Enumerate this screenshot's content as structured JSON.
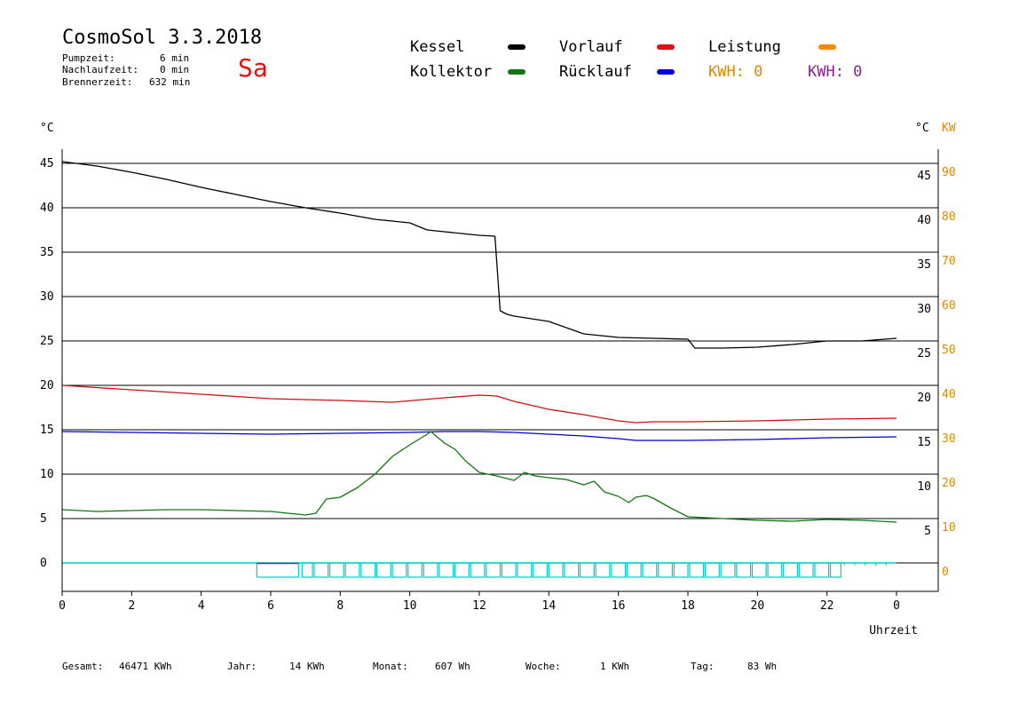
{
  "header": {
    "title": "CosmoSol 3.3.2018",
    "day": "Sa",
    "stats": [
      {
        "label": "Pumpzeit:",
        "value": "6 min"
      },
      {
        "label": "Nachlaufzeit:",
        "value": "0 min"
      },
      {
        "label": "Brennerzeit:",
        "value": "632 min"
      }
    ]
  },
  "legend": {
    "kessel": "Kessel",
    "vorlauf": "Vorlauf",
    "leistung": "Leistung",
    "kollektor": "Kollektor",
    "ruecklauf": "Rücklauf",
    "kwh1": "KWH: 0",
    "kwh2": "KWH: 0"
  },
  "colors": {
    "kessel": "#000000",
    "vorlauf": "#cc1111",
    "ruecklauf": "#0000cc",
    "kollektor": "#117711",
    "leistung": "#ff8800",
    "burner": "#00cccc",
    "pump": "#882288",
    "kwh2": "#882288",
    "axis_right_kw": "#dd8800"
  },
  "footer": [
    {
      "label": "Gesamt:",
      "value": "46471 KWh"
    },
    {
      "label": "Jahr:",
      "value": "14 KWh"
    },
    {
      "label": "Monat:",
      "value": "607 Wh"
    },
    {
      "label": "Woche:",
      "value": "1 KWh"
    },
    {
      "label": "Tag:",
      "value": "83 Wh"
    }
  ],
  "chart_data": {
    "type": "line",
    "ylabel_left": "°C",
    "ylabel_right": "°C",
    "ylabel_right_kw": "KW",
    "xlabel": "Uhrzeit",
    "xlim": [
      0,
      24
    ],
    "ylim": [
      0,
      45
    ],
    "grid": true,
    "y_ticks_left": [
      "0",
      "5",
      "10",
      "15",
      "20",
      "25",
      "30",
      "35",
      "40",
      "45"
    ],
    "y_ticks_right": [
      "5",
      "10",
      "15",
      "20",
      "25",
      "30",
      "35",
      "40",
      "45"
    ],
    "y_ticks_kw": [
      "0",
      "10",
      "20",
      "30",
      "40",
      "50",
      "60",
      "70",
      "80",
      "90"
    ],
    "x_ticks": [
      "0",
      "2",
      "4",
      "6",
      "8",
      "10",
      "12",
      "14",
      "16",
      "18",
      "20",
      "22",
      "0"
    ],
    "series": [
      {
        "name": "Kessel",
        "key": "kessel",
        "x": [
          0,
          1,
          2,
          3,
          4,
          5,
          6,
          7,
          8,
          9,
          10,
          10.5,
          11,
          12,
          12.45,
          12.6,
          12.8,
          13,
          14,
          15,
          16,
          17,
          18,
          18.2,
          19,
          20,
          21,
          22,
          23,
          24
        ],
        "y": [
          45.2,
          44.7,
          44.0,
          43.2,
          42.3,
          41.5,
          40.7,
          40.0,
          39.4,
          38.7,
          38.3,
          37.5,
          37.3,
          36.9,
          36.8,
          28.4,
          28.0,
          27.8,
          27.2,
          25.8,
          25.4,
          25.3,
          25.2,
          24.2,
          24.2,
          24.3,
          24.6,
          25.0,
          25.0,
          25.3
        ]
      },
      {
        "name": "Vorlauf",
        "key": "vorlauf",
        "x": [
          0,
          2,
          4,
          6,
          8,
          9.5,
          11,
          12,
          12.5,
          13,
          14,
          15,
          16,
          16.5,
          17,
          18,
          20,
          22,
          24
        ],
        "y": [
          20.0,
          19.5,
          19.0,
          18.5,
          18.3,
          18.1,
          18.6,
          18.9,
          18.8,
          18.2,
          17.3,
          16.7,
          16.0,
          15.8,
          15.9,
          15.9,
          16.0,
          16.2,
          16.3
        ]
      },
      {
        "name": "Rücklauf",
        "key": "ruecklauf",
        "x": [
          0,
          2,
          4,
          6,
          8,
          10,
          11,
          12,
          13,
          14,
          15,
          16,
          16.5,
          18,
          20,
          22,
          24
        ],
        "y": [
          14.8,
          14.7,
          14.6,
          14.5,
          14.6,
          14.7,
          14.8,
          14.8,
          14.7,
          14.5,
          14.3,
          14.0,
          13.8,
          13.8,
          13.9,
          14.1,
          14.2
        ]
      },
      {
        "name": "Kollektor",
        "key": "kollektor",
        "x": [
          0,
          1,
          2,
          3,
          4,
          5,
          6,
          7,
          7.3,
          7.6,
          8,
          8.5,
          9,
          9.5,
          10,
          10.5,
          10.6,
          11,
          11.3,
          11.6,
          12,
          12.5,
          13,
          13.3,
          13.6,
          14,
          14.5,
          15,
          15.3,
          15.6,
          16,
          16.3,
          16.5,
          16.8,
          17,
          17.5,
          18,
          19,
          20,
          21,
          22,
          23,
          24
        ],
        "y": [
          6.0,
          5.8,
          5.9,
          6.0,
          6.0,
          5.9,
          5.8,
          5.4,
          5.6,
          7.2,
          7.4,
          8.5,
          10.0,
          12.0,
          13.3,
          14.5,
          14.8,
          13.5,
          12.8,
          11.5,
          10.2,
          9.8,
          9.3,
          10.2,
          9.8,
          9.6,
          9.4,
          8.8,
          9.2,
          8.0,
          7.5,
          6.8,
          7.4,
          7.6,
          7.3,
          6.2,
          5.2,
          5.0,
          4.8,
          4.7,
          4.9,
          4.8,
          4.6
        ]
      }
    ],
    "burner_segments": [
      [
        5.6,
        6.8
      ],
      [
        6.9,
        7.2
      ],
      [
        7.25,
        7.65
      ],
      [
        7.7,
        8.1
      ],
      [
        8.15,
        8.55
      ],
      [
        8.6,
        9.0
      ],
      [
        9.05,
        9.45
      ],
      [
        9.5,
        9.9
      ],
      [
        9.95,
        10.35
      ],
      [
        10.4,
        10.8
      ],
      [
        10.85,
        11.25
      ],
      [
        11.3,
        11.7
      ],
      [
        11.75,
        12.15
      ],
      [
        12.2,
        12.6
      ],
      [
        12.65,
        13.05
      ],
      [
        13.1,
        13.5
      ],
      [
        13.55,
        13.95
      ],
      [
        14.0,
        14.4
      ],
      [
        14.45,
        14.85
      ],
      [
        14.9,
        15.3
      ],
      [
        15.35,
        15.75
      ],
      [
        15.8,
        16.2
      ],
      [
        16.25,
        16.65
      ],
      [
        16.7,
        17.1
      ],
      [
        17.15,
        17.55
      ],
      [
        17.6,
        18.0
      ],
      [
        18.05,
        18.45
      ],
      [
        18.5,
        18.9
      ],
      [
        18.95,
        19.35
      ],
      [
        19.4,
        19.8
      ],
      [
        19.85,
        20.25
      ],
      [
        20.3,
        20.7
      ],
      [
        20.75,
        21.15
      ],
      [
        21.2,
        21.6
      ],
      [
        21.65,
        22.05
      ],
      [
        22.1,
        22.4
      ]
    ],
    "burner_level": 1.6
  }
}
